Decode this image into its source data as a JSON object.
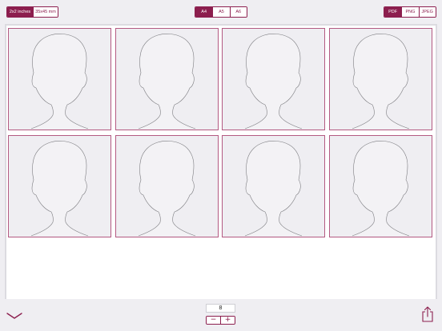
{
  "toolbar": {
    "photo_size": {
      "options": [
        "2x2 inches",
        "35x45 mm"
      ],
      "selected": "2x2 inches"
    },
    "paper_size": {
      "options": [
        "A4",
        "A5",
        "A6"
      ],
      "selected": "A4"
    },
    "export_format": {
      "options": [
        "PDF",
        "PNG",
        "JPEG"
      ],
      "selected": "PDF"
    }
  },
  "sheet": {
    "photo_count": 8,
    "photo_placeholder_icon": "person-silhouette-icon"
  },
  "bottom": {
    "count_value": "8",
    "decrement_label": "−",
    "increment_label": "+",
    "collapse_icon": "chevron-down-icon",
    "share_icon": "share-icon"
  },
  "colors": {
    "accent": "#8c1e4e",
    "background": "#efeef2",
    "photo_border": "#b45a82"
  }
}
